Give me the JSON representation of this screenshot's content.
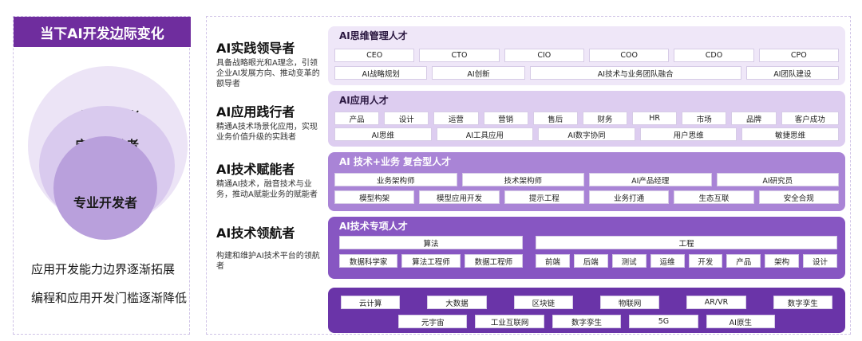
{
  "left": {
    "title": "当下AI开发边际变化",
    "circles": [
      "全民开发者",
      "应用开发者",
      "专业开发者"
    ],
    "notes": [
      "应用开发能力边界逐渐拓展",
      "编程和应用开发门槛逐渐降低"
    ]
  },
  "roles": [
    {
      "title": "AI实践领导者",
      "desc": "具备战略眼光和A理念，引领企业AI发展方向、推动变革的额导者"
    },
    {
      "title": "AI应用践行者",
      "desc": "精通A技术场景化应用，实现业务价值升级的实践者"
    },
    {
      "title": "AI技术赋能者",
      "desc": "精通AI技术，融音技术与业务，推动A赋能业务的赋能者"
    },
    {
      "title": "AI技术领航者",
      "desc": "构建和维护AI技术平台的领航者"
    }
  ],
  "bands": [
    {
      "title": "AI思维管理人才",
      "rows": [
        [
          "CEO",
          "CTO",
          "CIO",
          "COO",
          "CDO",
          "CPO"
        ],
        [
          "AI战略规划",
          "AI创新",
          "AI技术与业务团队融合",
          "AI团队建设"
        ]
      ]
    },
    {
      "title": "AI应用人才",
      "rows": [
        [
          "产品",
          "设计",
          "运营",
          "营销",
          "售后",
          "财务",
          "HR",
          "市场",
          "品牌",
          "客户成功"
        ],
        [
          "AI思维",
          "AI工具应用",
          "AI数字协同",
          "用户思维",
          "敏捷思维"
        ]
      ]
    },
    {
      "title": "AI 技术+业务 复合型人才",
      "rows": [
        [
          "业务架构师",
          "技术架构师",
          "AI产品经理",
          "AI研究员"
        ],
        [
          "模型构架",
          "模型应用开发",
          "提示工程",
          "业务打通",
          "生态互联",
          "安全合规"
        ]
      ]
    },
    {
      "title": "AI技术专项人才",
      "groups": [
        {
          "head": "算法",
          "items": [
            "数据科学家",
            "算法工程师",
            "数据工程师"
          ]
        },
        {
          "head": "工程",
          "items": [
            "前端",
            "后端",
            "测试",
            "运维",
            "开发",
            "产品",
            "架构",
            "设计"
          ]
        }
      ]
    },
    {
      "title": "",
      "rows": [
        [
          "云计算",
          "大数据",
          "区块链",
          "物联网",
          "AR/VR",
          "数字孪生"
        ],
        [
          "元宇宙",
          "工业互联网",
          "数字孪生",
          "5G",
          "AI原生"
        ]
      ]
    }
  ]
}
